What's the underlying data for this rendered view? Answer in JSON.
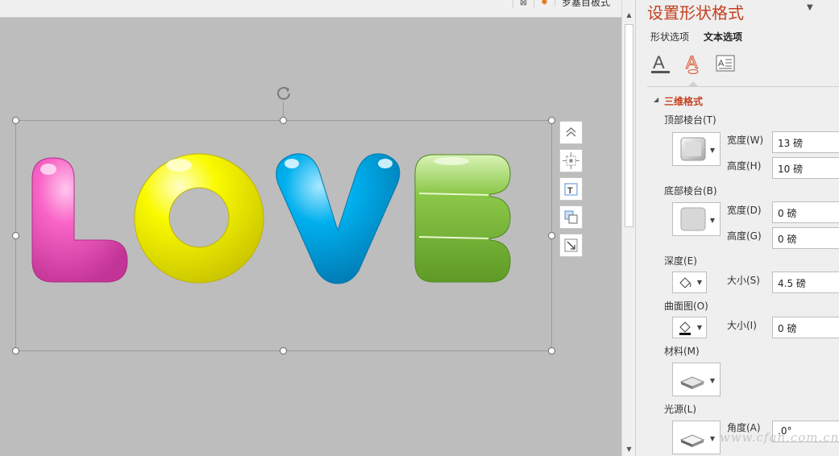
{
  "toolbar": {
    "btn_a_glyph": "⊠",
    "btn_b_glyph": "✸",
    "btn_c_label": "罗塞目板式"
  },
  "canvas": {
    "word_letters": [
      "L",
      "O",
      "V",
      "E"
    ],
    "letter_colors": [
      "#f964c7",
      "#fafa00",
      "#00b0ee",
      "#8cc94a"
    ],
    "background_color": "#bdbdbd"
  },
  "side_toolbar": {
    "icons": [
      "chevron-up-icon",
      "position-icon",
      "text-box-icon",
      "arrange-icon",
      "resize-icon"
    ]
  },
  "pane": {
    "title": "设置形状格式",
    "tabs": [
      "形状选项",
      "文本选项"
    ],
    "section_title": "三维格式",
    "top_bevel_label": "顶部棱台(T)",
    "bottom_bevel_label": "底部棱台(B)",
    "width_label": "宽度(W)",
    "height_label": "高度(H)",
    "width_label_d": "宽度(D)",
    "height_label_g": "高度(G)",
    "top_width_value": "13 磅",
    "top_height_value": "10 磅",
    "bottom_width_value": "0 磅",
    "bottom_height_value": "0 磅",
    "depth_label": "深度(E)",
    "depth_size_label": "大小(S)",
    "depth_size_value": "4.5 磅",
    "contour_label": "曲面图(O)",
    "contour_size_label": "大小(I)",
    "contour_size_value": "0 磅",
    "material_label": "材料(M)",
    "lighting_label": "光源(L)",
    "angle_label": "角度(A)",
    "angle_value": ".0°"
  },
  "watermark": "www.cfan.com.cn",
  "colors": {
    "accent": "#c3401f"
  }
}
